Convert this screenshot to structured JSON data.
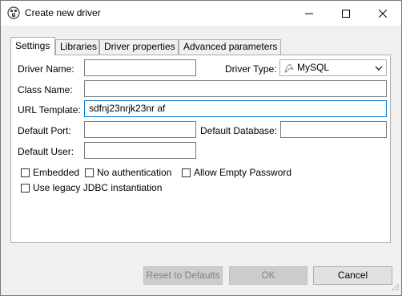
{
  "window": {
    "title": "Create new driver",
    "app_icon": "dbeaver-beaver-icon",
    "controls": [
      "minimize-icon",
      "maximize-icon",
      "close-icon"
    ]
  },
  "tabs": [
    {
      "label": "Settings",
      "active": true
    },
    {
      "label": "Libraries",
      "active": false
    },
    {
      "label": "Driver properties",
      "active": false
    },
    {
      "label": "Advanced parameters",
      "active": false
    }
  ],
  "form": {
    "driver_name": {
      "label": "Driver Name:",
      "value": ""
    },
    "driver_type": {
      "label": "Driver Type:",
      "value": "MySQL",
      "icon": "mysql-dolphin-icon"
    },
    "class_name": {
      "label": "Class Name:",
      "value": ""
    },
    "url_template": {
      "label": "URL Template:",
      "value": "sdfnj23nrjk23nr af"
    },
    "default_port": {
      "label": "Default Port:",
      "value": ""
    },
    "default_database": {
      "label": "Default Database:",
      "value": ""
    },
    "default_user": {
      "label": "Default User:",
      "value": ""
    }
  },
  "options": {
    "embedded": {
      "label": "Embedded",
      "checked": false
    },
    "no_authentication": {
      "label": "No authentication",
      "checked": false
    },
    "allow_empty_password": {
      "label": "Allow Empty Password",
      "checked": false
    },
    "legacy_jdbc": {
      "label": "Use legacy JDBC instantiation",
      "checked": false
    }
  },
  "buttons": {
    "reset": {
      "label": "Reset to Defaults",
      "enabled": false
    },
    "ok": {
      "label": "OK",
      "enabled": false
    },
    "cancel": {
      "label": "Cancel",
      "enabled": true
    }
  },
  "colors": {
    "focus_border": "#0078d7",
    "disabled_button": "#cccccc",
    "window_bg": "#f0f0f0"
  }
}
